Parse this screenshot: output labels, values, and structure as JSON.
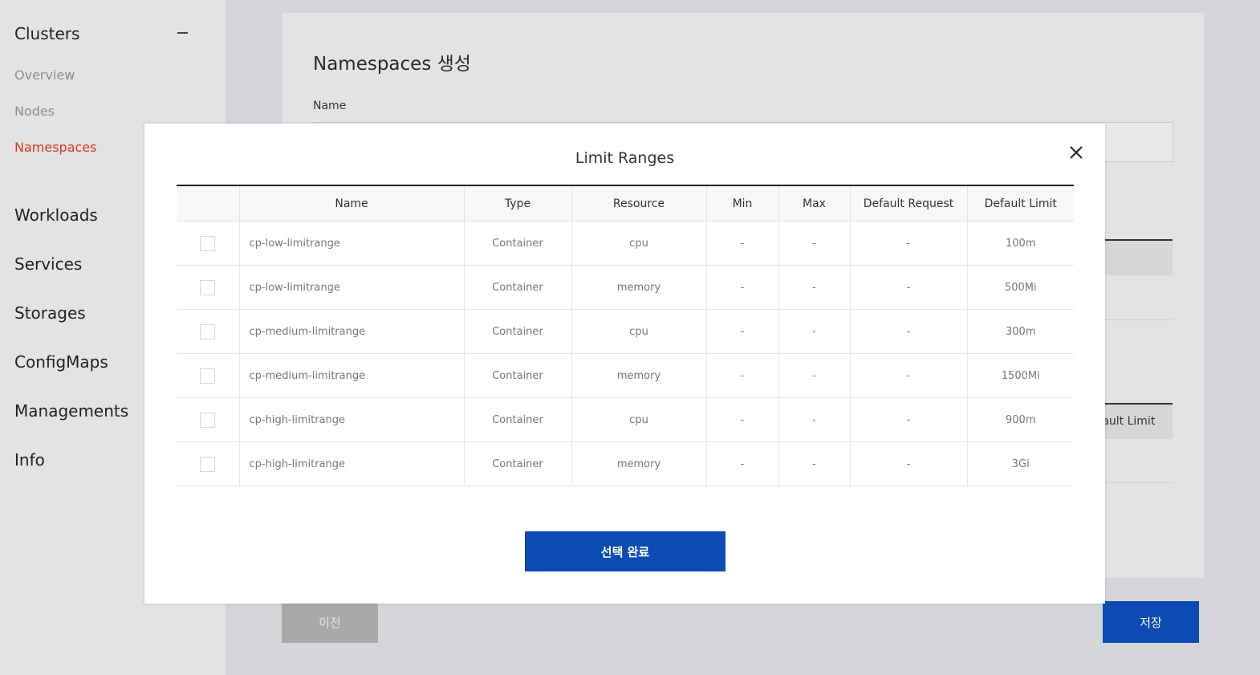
{
  "sidebar": {
    "clusters": "Clusters",
    "sub": [
      "Overview",
      "Nodes",
      "Namespaces"
    ],
    "groups": [
      "Workloads",
      "Services",
      "Storages",
      "ConfigMaps",
      "Managements",
      "Info"
    ]
  },
  "page": {
    "title": "Namespaces 생성",
    "name_label": "Name",
    "partial_header": "Default Limit",
    "prev_label": "이전",
    "save_label": "저장"
  },
  "modal": {
    "title": "Limit Ranges",
    "columns": [
      "",
      "Name",
      "Type",
      "Resource",
      "Min",
      "Max",
      "Default Request",
      "Default Limit"
    ],
    "rows": [
      {
        "name": "cp-low-limitrange",
        "type": "Container",
        "resource": "cpu",
        "min": "-",
        "max": "-",
        "default_request": "-",
        "default_limit": "100m"
      },
      {
        "name": "cp-low-limitrange",
        "type": "Container",
        "resource": "memory",
        "min": "-",
        "max": "-",
        "default_request": "-",
        "default_limit": "500Mi"
      },
      {
        "name": "cp-medium-limitrange",
        "type": "Container",
        "resource": "cpu",
        "min": "-",
        "max": "-",
        "default_request": "-",
        "default_limit": "300m"
      },
      {
        "name": "cp-medium-limitrange",
        "type": "Container",
        "resource": "memory",
        "min": "-",
        "max": "-",
        "default_request": "-",
        "default_limit": "1500Mi"
      },
      {
        "name": "cp-high-limitrange",
        "type": "Container",
        "resource": "cpu",
        "min": "-",
        "max": "-",
        "default_request": "-",
        "default_limit": "900m"
      },
      {
        "name": "cp-high-limitrange",
        "type": "Container",
        "resource": "memory",
        "min": "-",
        "max": "-",
        "default_request": "-",
        "default_limit": "3Gi"
      }
    ],
    "confirm_label": "선택 완료"
  },
  "colors": {
    "accent": "#0b4bb3",
    "active_nav": "#d9381e"
  }
}
